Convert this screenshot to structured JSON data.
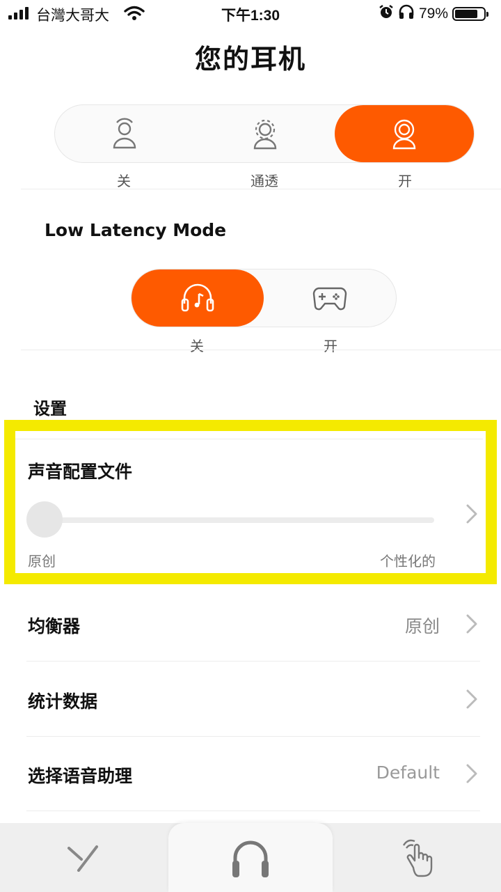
{
  "status_bar": {
    "carrier": "台灣大哥大",
    "time": "下午1:30",
    "battery_text": "79%",
    "battery_level": 0.79
  },
  "page": {
    "title": "您的耳机"
  },
  "anc": {
    "options": [
      {
        "label": "关",
        "icon": "person-icon",
        "selected": false
      },
      {
        "label": "通透",
        "icon": "person-ambient-icon",
        "selected": false
      },
      {
        "label": "开",
        "icon": "person-anc-icon",
        "selected": true
      }
    ],
    "accent": "#fe5a00"
  },
  "low_latency": {
    "heading": "Low Latency Mode",
    "options": [
      {
        "label": "关",
        "icon": "headphones-music-icon",
        "selected": true
      },
      {
        "label": "开",
        "icon": "gamepad-icon",
        "selected": false
      }
    ]
  },
  "settings": {
    "heading": "设置",
    "sound_profile": {
      "title": "声音配置文件",
      "min_label": "原创",
      "max_label": "个性化的",
      "level": 0
    },
    "rows": [
      {
        "title": "均衡器",
        "value": "原创"
      },
      {
        "title": "统计数据",
        "value": ""
      },
      {
        "title": "选择语音助理",
        "value": "Default"
      }
    ]
  },
  "tabbar": {
    "tabs": [
      {
        "icon": "y-logo-icon",
        "active": false
      },
      {
        "icon": "headphones-icon",
        "active": true
      },
      {
        "icon": "touch-gesture-icon",
        "active": false
      }
    ]
  }
}
